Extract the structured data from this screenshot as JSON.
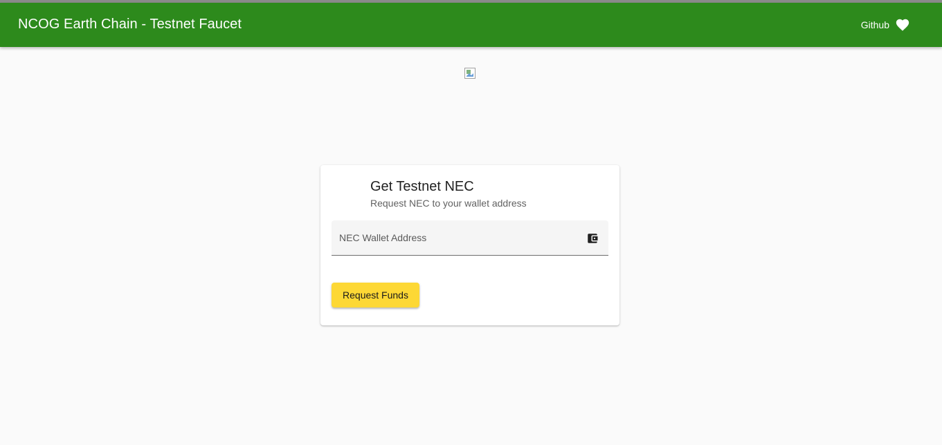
{
  "toolbar": {
    "title": "NCOG Earth Chain - Testnet Faucet",
    "github_label": "Github",
    "github_icon": "heart-icon",
    "background_color": "#2d8a1c"
  },
  "logo": {
    "icon": "broken-image-icon"
  },
  "card": {
    "title": "Get Testnet NEC",
    "subtitle": "Request NEC to your wallet address",
    "address_field": {
      "placeholder": "NEC Wallet Address",
      "value": "",
      "icon": "wallet-icon"
    },
    "request_button_label": "Request Funds",
    "button_color": "#fdd835"
  }
}
